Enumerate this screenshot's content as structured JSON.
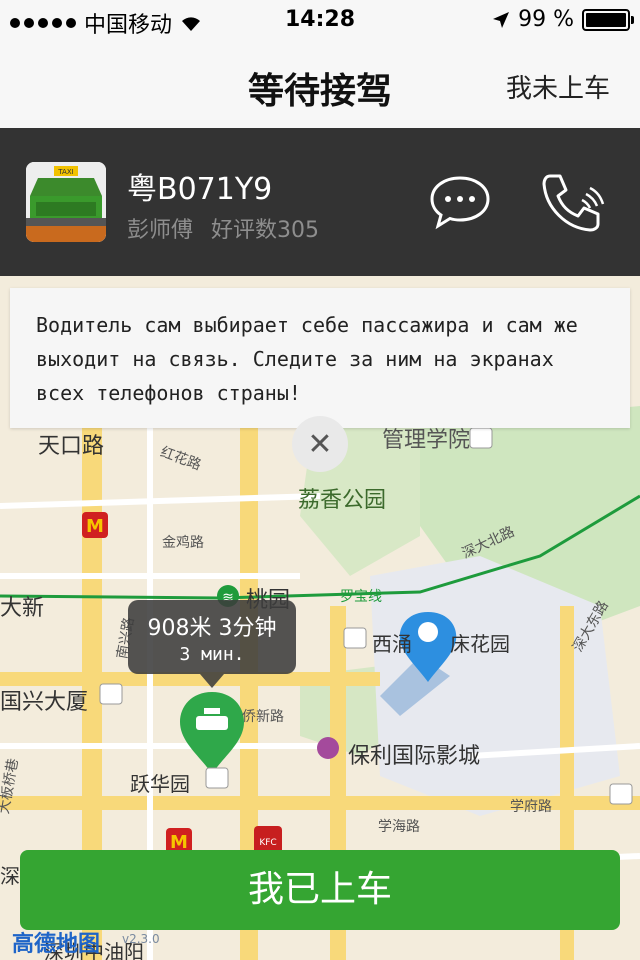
{
  "status_bar": {
    "carrier": "中国移动",
    "time": "14:28",
    "battery": "99 %",
    "battery_level": 0.99
  },
  "nav": {
    "title": "等待接驾",
    "right_action": "我未上车"
  },
  "driver": {
    "plate": "粤B071Y9",
    "name": "彭师傅",
    "rating": "好评数305",
    "taxi_sign": "TAXI"
  },
  "notice": {
    "text": "Водитель сам выбирает себе пассажира и сам же выходит на связь. Следите за ним на экранах всех телефонов страны!"
  },
  "map": {
    "labels": {
      "tiankou": "天口路",
      "honghua": "红花路",
      "management": "管理学院",
      "lizhi_park": "荔香公园",
      "jinjiu": "金鸡路",
      "shenda_north": "深大北路",
      "daxin": "大新",
      "taoyuan": "桃园",
      "luobao_line": "罗宝线",
      "xixiang_garden": "西涌",
      "garden_suffix": "床花园",
      "shenda_east": "深大东路",
      "nanxing": "南兴路",
      "guoxing": "国兴大厦",
      "qiaoxin": "侨新路",
      "poly_cinema": "保利国际影城",
      "yuehua": "跃华园",
      "xuefu": "学府路",
      "xuehai": "学海路",
      "dajian_bridge": "大板桥巷",
      "shenzhen_oil": "深圳中油阳",
      "shende": "深德"
    },
    "eta": {
      "line1": "908米 3分钟",
      "line2": "3 мин."
    },
    "mcd_icon": "M",
    "kfc_icon": "KFC"
  },
  "confirm_button": "我已上车",
  "logo": {
    "text": "高德地图",
    "version": "v2.3.0"
  },
  "colors": {
    "green": "#35a532",
    "dark_bar": "#333333",
    "metro_green": "#1e9b3c"
  }
}
